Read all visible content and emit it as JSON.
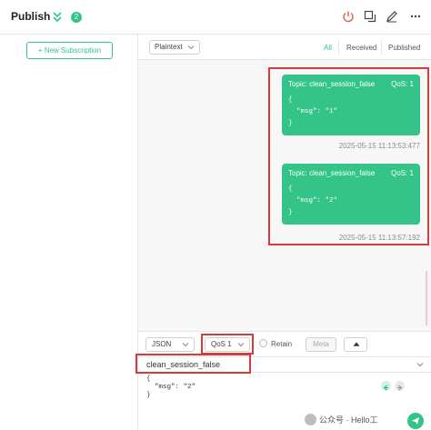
{
  "header": {
    "title": "Publish",
    "badge": "2"
  },
  "sidebar": {
    "new_subscription": "+ New Subscription"
  },
  "toolbar": {
    "format": "Plaintext",
    "filters": [
      "All",
      "Received",
      "Published"
    ],
    "active_filter": "All"
  },
  "messages": [
    {
      "topic": "Topic: clean_session_false",
      "qos": "QoS: 1",
      "payload": "{\n  \"msg\": \"1\"\n}",
      "time": "2025-05-15 11:13:53:477"
    },
    {
      "topic": "Topic: clean_session_false",
      "qos": "QoS: 1",
      "payload": "{\n  \"msg\": \"2\"\n}",
      "time": "2025-05-15 11:13:57:192"
    }
  ],
  "publish": {
    "payload_format": "JSON",
    "qos": "QoS 1",
    "retain_label": "Retain",
    "meta_label": "Meta",
    "topic": "clean_session_false",
    "payload": "{\n  \"msg\": \"2\"\n}"
  },
  "watermark": "公众号 · Hello工",
  "colors": {
    "accent": "#34c388",
    "highlight": "#d63a3a"
  },
  "icons": [
    "chevron-double-down-icon",
    "power-icon",
    "copy-icon",
    "edit-icon",
    "more-icon",
    "chevron-down-icon",
    "arrow-up-icon",
    "arrow-left-icon",
    "arrow-right-icon",
    "send-icon"
  ]
}
